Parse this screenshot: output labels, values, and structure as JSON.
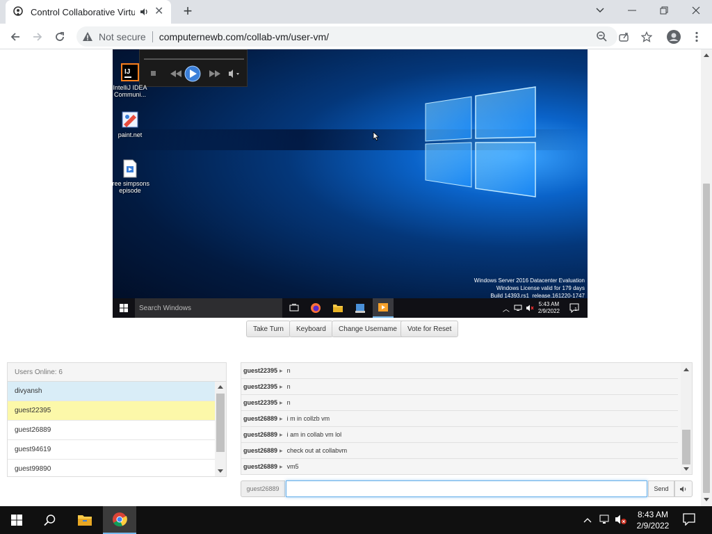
{
  "browser": {
    "tab_title": "Control Collaborative Virtual",
    "not_secure": "Not secure",
    "url": "computernewb.com/collab-vm/user-vm/"
  },
  "vm": {
    "desktop_icons": [
      {
        "label": "IntelliJ IDEA Communi...",
        "icon": "intellij-icon"
      },
      {
        "label": "paint.net",
        "icon": "paintnet-icon"
      },
      {
        "label": "free simpsons episode",
        "icon": "video-file-icon"
      }
    ],
    "watermark": {
      "line1": "Windows Server 2016 Datacenter Evaluation",
      "line2": "Windows License valid for 179 days",
      "line3": "Build 14393.rs1_release.161220-1747"
    },
    "taskbar_search": "Search Windows",
    "clock_time": "5:43 AM",
    "clock_date": "2/9/2022",
    "notification_count": "1"
  },
  "controls": {
    "take_turn": "Take Turn",
    "keyboard": "Keyboard",
    "change_username": "Change Username",
    "vote_reset": "Vote for Reset"
  },
  "users": {
    "header": "Users Online: 6",
    "list": [
      {
        "name": "divyansh",
        "color": "#d9edf7"
      },
      {
        "name": "guest22395",
        "color": "#fcf8a9"
      },
      {
        "name": "guest26889",
        "color": "#ffffff"
      },
      {
        "name": "guest94619",
        "color": "#ffffff"
      },
      {
        "name": "guest99890",
        "color": "#ffffff"
      }
    ]
  },
  "chat": {
    "messages": [
      {
        "user": "guest22395",
        "text": "n"
      },
      {
        "user": "guest22395",
        "text": "n"
      },
      {
        "user": "guest22395",
        "text": "n"
      },
      {
        "user": "guest26889",
        "text": "i m in collzb vm"
      },
      {
        "user": "guest26889",
        "text": "i am in collab vm lol"
      },
      {
        "user": "guest26889",
        "text": "check out at collabvm"
      },
      {
        "user": "guest26889",
        "text": "vm5"
      }
    ],
    "separator": "▸",
    "username": "guest26889",
    "input_value": "",
    "send_label": "Send"
  },
  "system": {
    "time": "8:43 AM",
    "date": "2/9/2022"
  },
  "colors": {
    "accent": "#66afe9",
    "chrome_tabstrip": "#dee1e6"
  }
}
